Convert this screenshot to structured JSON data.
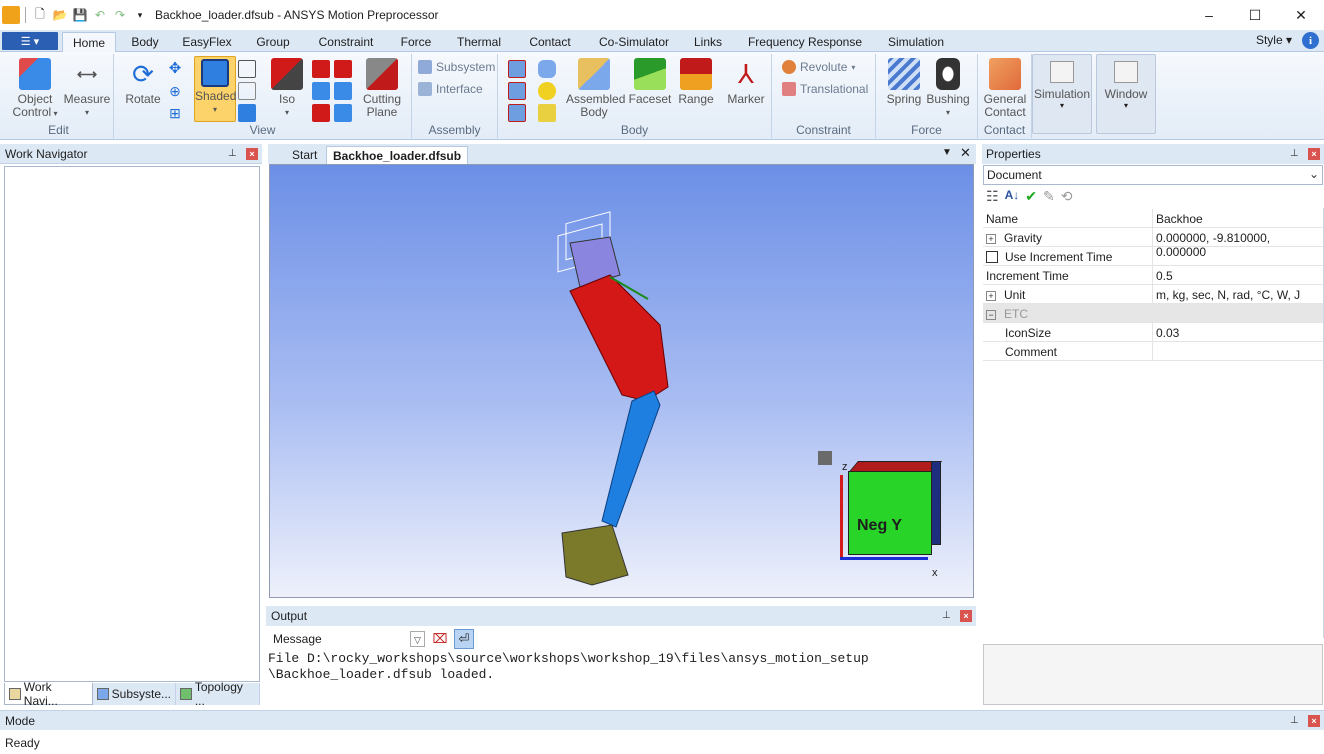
{
  "window": {
    "title": "Backhoe_loader.dfsub - ANSYS Motion Preprocessor",
    "minimize": "–",
    "maximize": "☐",
    "close": "✕"
  },
  "ribbon_tabs": [
    "Home",
    "Body",
    "EasyFlex",
    "Group",
    "Constraint",
    "Force",
    "Thermal",
    "Contact",
    "Co-Simulator",
    "Links",
    "Frequency Response",
    "Simulation"
  ],
  "style_label": "Style",
  "info_label": "i",
  "file_button": "☰ ▾",
  "groups": {
    "edit": {
      "label": "Edit",
      "object_control": "Object\nControl",
      "measure": "Measure"
    },
    "view": {
      "label": "View",
      "rotate": "Rotate",
      "shaded": "Shaded",
      "iso": "Iso",
      "cutting_plane": "Cutting\nPlane"
    },
    "assembly": {
      "label": "Assembly",
      "subsystem": "Subsystem",
      "interface": "Interface"
    },
    "body": {
      "label": "Body",
      "assembled_body": "Assembled\nBody",
      "faceset": "Faceset",
      "range": "Range",
      "marker": "Marker"
    },
    "constraint": {
      "label": "Constraint",
      "revolute": "Revolute",
      "translational": "Translational"
    },
    "force": {
      "label": "Force",
      "spring": "Spring",
      "bushing": "Bushing"
    },
    "contact": {
      "label": "Contact",
      "general_contact": "General\nContact"
    },
    "simulation": {
      "label": "Simulation"
    },
    "window": {
      "label": "Window"
    }
  },
  "work_navigator": {
    "title": "Work Navigator",
    "tabs": [
      "Work Navi...",
      "Subsyste...",
      "Topology ..."
    ]
  },
  "doc_tabs": {
    "start": "Start",
    "active": "Backhoe_loader.dfsub"
  },
  "viewcube": {
    "face": "Neg Y",
    "x_label": "x",
    "z_label": "z"
  },
  "output": {
    "title": "Output",
    "filter": "Message",
    "lines": [
      "File D:\\rocky_workshops\\source\\workshops\\workshop_19\\files\\ansys_motion_setup",
      "\\Backhoe_loader.dfsub loaded."
    ]
  },
  "properties": {
    "title": "Properties",
    "selector": "Document",
    "header": {
      "name": "Name",
      "value": "Backhoe"
    },
    "rows": [
      {
        "key": "Gravity",
        "value": "0.000000, -9.810000, 0.000000"
      },
      {
        "key": "Use Increment Time",
        "value": ""
      },
      {
        "key": "Increment Time",
        "value": "0.5"
      },
      {
        "key": "Unit",
        "value": "m, kg, sec, N, rad, °C, W, J"
      },
      {
        "key": "ETC",
        "value": ""
      },
      {
        "key": "IconSize",
        "value": "0.03"
      },
      {
        "key": "Comment",
        "value": ""
      }
    ]
  },
  "mode": {
    "title": "Mode"
  },
  "status": {
    "text": "Ready"
  },
  "colors": {
    "ribbon_tab_bg": "#dde8f5",
    "accent": "#2b5fb3",
    "arm_red": "#d41818",
    "arm_blue": "#1f7fe0",
    "bucket": "#7a7a2a"
  }
}
